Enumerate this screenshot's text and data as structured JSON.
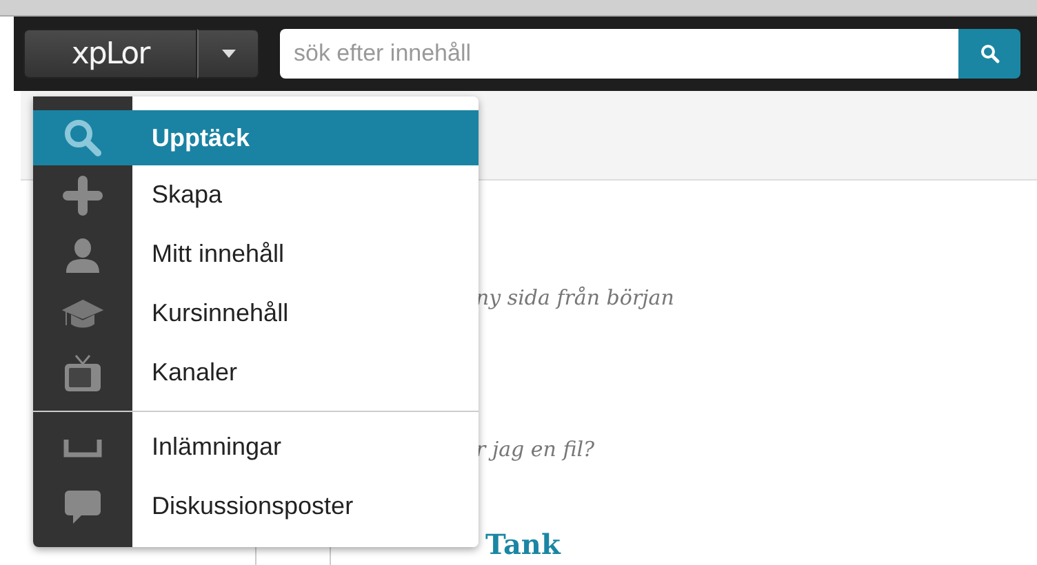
{
  "header": {
    "logo": "xpLor",
    "search": {
      "placeholder": "sök efter innehåll"
    }
  },
  "menu": {
    "sections": [
      [
        {
          "label": "Upptäck",
          "selected": true
        },
        {
          "label": "Skapa",
          "selected": false
        },
        {
          "label": "Mitt innehåll",
          "selected": false
        },
        {
          "label": "Kursinnehåll",
          "selected": false
        },
        {
          "label": "Kanaler",
          "selected": false
        }
      ],
      [
        {
          "label": "Inlämningar",
          "selected": false
        },
        {
          "label": "Diskussionsposter",
          "selected": false
        }
      ]
    ]
  },
  "content": {
    "lines": [
      "ny sida från början",
      "r jag en fil?"
    ],
    "heading": "Tank"
  }
}
